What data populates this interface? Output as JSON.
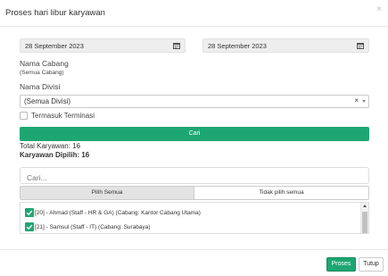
{
  "dialog": {
    "title": "Proses hari libur karyawan",
    "close_glyph": "×"
  },
  "filters": {
    "start_date": "28 September 2023",
    "end_date": "28 September 2023",
    "cabang_label": "Nama Cabang",
    "cabang_value": "(Semua Cabang)",
    "divisi_label": "Nama Divisi",
    "divisi_value": "(Semua Divisi)",
    "divisi_clear": "×",
    "termasuk_label": "Termasuk Terminasi",
    "termasuk_checked": false,
    "cari_label": "Cari"
  },
  "summary": {
    "total_label": "Total Karyawan: 16",
    "selected_label": "Karyawan Dipilih: 16"
  },
  "search": {
    "placeholder": "Cari..."
  },
  "selection": {
    "select_all_label": "Pilih Semua",
    "deselect_all_label": "Tidak pilih semua"
  },
  "employees": [
    {
      "label": "[20] - Ahmad (Staff - HR & GA) (Cabang: Kantor Cabang Utama)",
      "checked": true
    },
    {
      "label": "[21] - Samsul (Staff - IT) (Cabang: Surabaya)",
      "checked": true
    }
  ],
  "footer": {
    "proses_label": "Proses",
    "tutup_label": "Tutup"
  },
  "colors": {
    "accent": "#1ea672"
  },
  "icons": {
    "calendar": "calendar-icon",
    "close": "close-icon",
    "dropdown": "chevron-down-icon",
    "checkbox": "checkbox-checked-icon"
  }
}
